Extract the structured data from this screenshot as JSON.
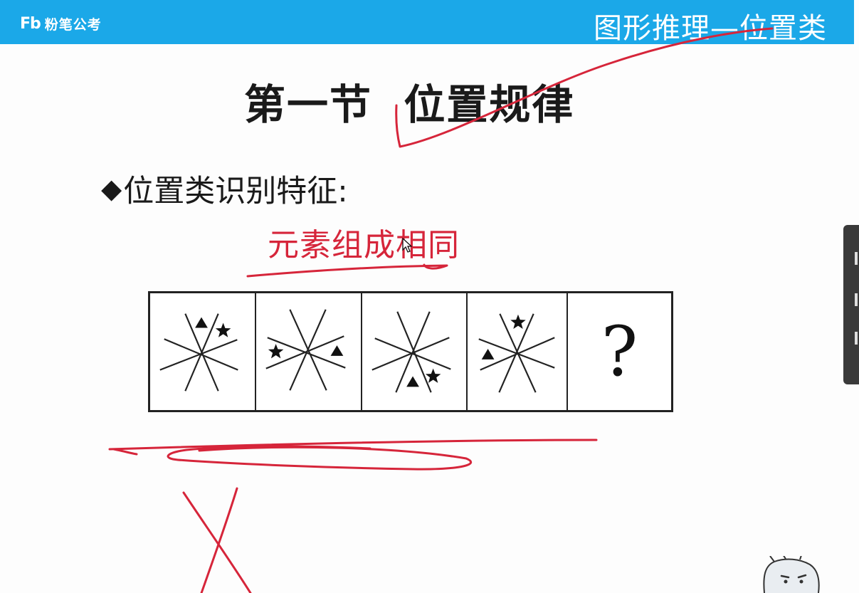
{
  "header": {
    "logo_mark": "Fb",
    "logo_text": "粉笔公考",
    "title": "图形推理—位置类"
  },
  "slide": {
    "title": "第一节  位置规律",
    "bullet_symbol": "◆",
    "bullet_text": "位置类识别特征:",
    "handwritten_note": "元素组成相同",
    "question_mark": "?"
  },
  "puzzle": {
    "cells": [
      {
        "label": "panel-1",
        "triangle_position": "top-right",
        "star_position": "top-right"
      },
      {
        "label": "panel-2",
        "triangle_position": "right",
        "star_position": "left"
      },
      {
        "label": "panel-3",
        "triangle_position": "bottom",
        "star_position": "bottom-right"
      },
      {
        "label": "panel-4",
        "triangle_position": "left",
        "star_position": "top"
      },
      {
        "label": "panel-5",
        "content": "question"
      }
    ]
  },
  "colors": {
    "header_bg": "#1ba8e8",
    "ink_red": "#d6253a",
    "text": "#1a1a1a"
  }
}
